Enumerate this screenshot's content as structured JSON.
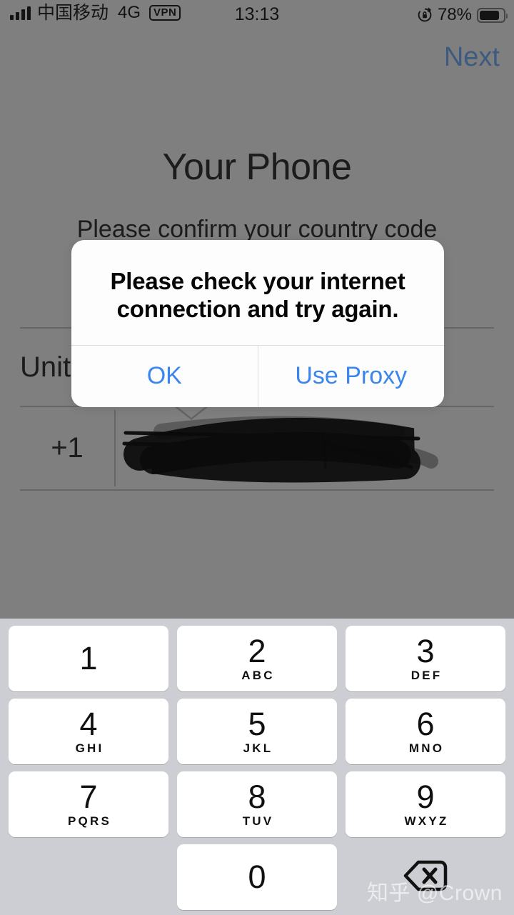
{
  "status_bar": {
    "carrier": "中国移动",
    "network_type": "4G",
    "vpn_badge": "VPN",
    "time": "13:13",
    "battery_percent": "78%",
    "signal_bars": 4,
    "rotation_lock_icon": "rotation-lock-icon",
    "battery_icon": "battery-icon"
  },
  "nav": {
    "next_label": "Next",
    "next_color": "#3d5a80"
  },
  "screen": {
    "title": "Your Phone",
    "subtitle": "Please confirm your country code",
    "country_name": "United States",
    "country_code": "+1",
    "phone_number": "",
    "phone_number_redacted": true
  },
  "alert": {
    "message": "Please check your internet connection and try again.",
    "buttons": [
      {
        "label": "OK",
        "name": "alert-btn-ok"
      },
      {
        "label": "Use Proxy",
        "name": "alert-btn-use-proxy"
      }
    ],
    "tint_color": "#3b85ef"
  },
  "keypad": {
    "rows": [
      [
        {
          "num": "1",
          "sub": ""
        },
        {
          "num": "2",
          "sub": "ABC"
        },
        {
          "num": "3",
          "sub": "DEF"
        }
      ],
      [
        {
          "num": "4",
          "sub": "GHI"
        },
        {
          "num": "5",
          "sub": "JKL"
        },
        {
          "num": "6",
          "sub": "MNO"
        }
      ],
      [
        {
          "num": "7",
          "sub": "PQRS"
        },
        {
          "num": "8",
          "sub": "TUV"
        },
        {
          "num": "9",
          "sub": "WXYZ"
        }
      ]
    ],
    "zero_key": {
      "num": "0",
      "sub": ""
    },
    "delete_icon": "backspace-delete-icon",
    "background_color": "#cdced3",
    "key_color": "#ffffff"
  },
  "watermark": {
    "text": "知乎 @Crown"
  }
}
